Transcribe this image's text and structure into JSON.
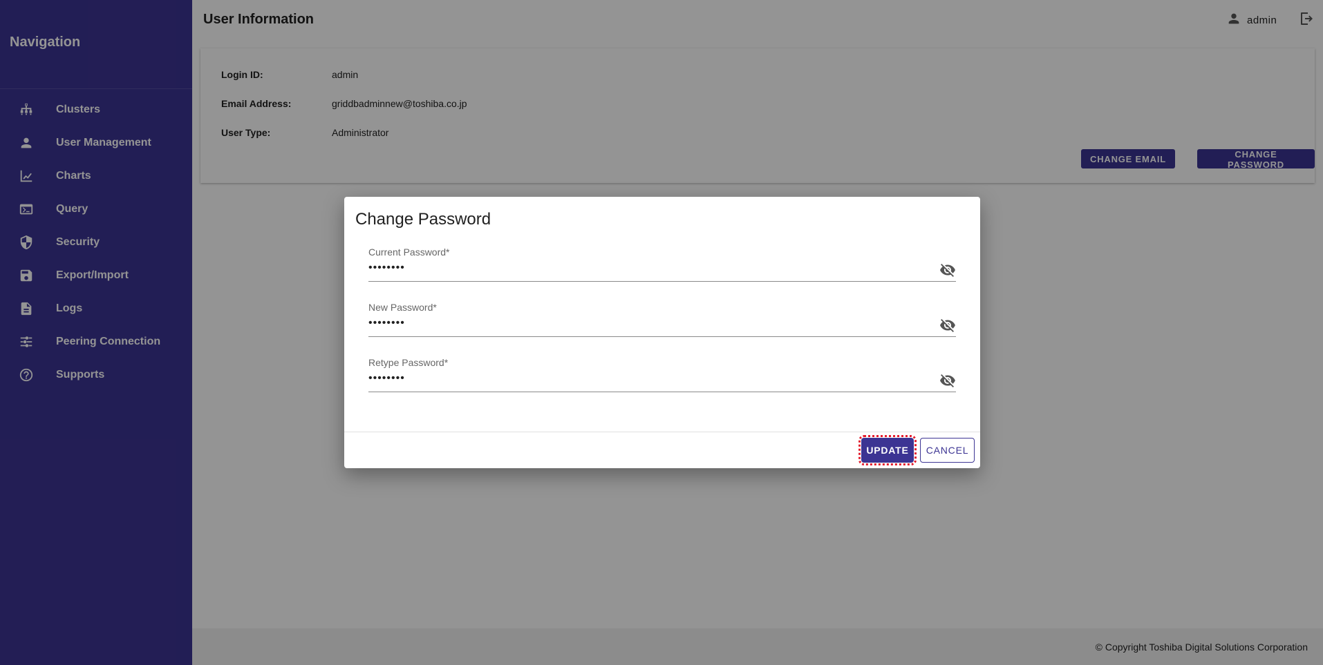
{
  "sidebar": {
    "title": "Navigation",
    "items": [
      {
        "label": "Clusters",
        "icon": "clusters-icon"
      },
      {
        "label": "User Management",
        "icon": "person-icon"
      },
      {
        "label": "Charts",
        "icon": "line-chart-icon"
      },
      {
        "label": "Query",
        "icon": "terminal-icon"
      },
      {
        "label": "Security",
        "icon": "shield-icon"
      },
      {
        "label": "Export/Import",
        "icon": "save-icon"
      },
      {
        "label": "Logs",
        "icon": "document-icon"
      },
      {
        "label": "Peering Connection",
        "icon": "peering-icon"
      },
      {
        "label": "Supports",
        "icon": "help-icon"
      }
    ],
    "color": "#3c3493"
  },
  "header": {
    "title": "User Information",
    "user": "admin"
  },
  "user_info": {
    "login_id_label": "Login ID:",
    "login_id": "admin",
    "email_label": "Email Address:",
    "email": "griddbadminnew@toshiba.co.jp",
    "user_type_label": "User Type:",
    "user_type": "Administrator",
    "change_email_label": "CHANGE EMAIL",
    "change_password_label": "CHANGE PASSWORD"
  },
  "dialog": {
    "title": "Change Password",
    "fields": [
      {
        "label": "Current Password*",
        "value": "••••••••"
      },
      {
        "label": "New Password*",
        "value": "••••••••"
      },
      {
        "label": "Retype Password*",
        "value": "••••••••"
      }
    ],
    "update_label": "UPDATE",
    "cancel_label": "CANCEL"
  },
  "footer": {
    "copyright": "© Copyright Toshiba Digital Solutions Corporation"
  },
  "colors": {
    "accent": "#3c3493",
    "highlight": "#e31c2d"
  }
}
